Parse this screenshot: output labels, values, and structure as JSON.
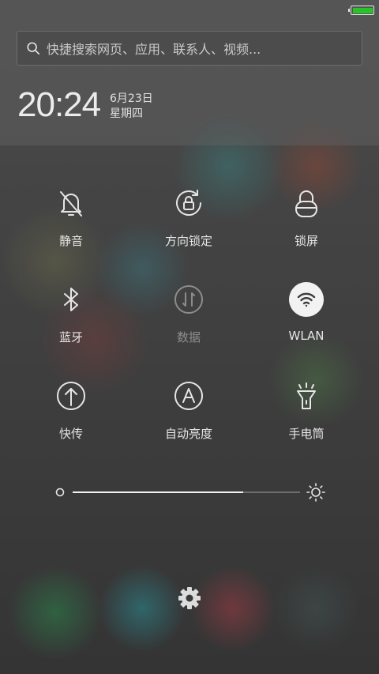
{
  "status_bar": {
    "battery_icon": "battery-icon",
    "battery_level": 1.0,
    "battery_color": "#27c327"
  },
  "search": {
    "placeholder": "快捷搜索网页、应用、联系人、视频...",
    "icon": "search-icon"
  },
  "clock": {
    "time": "20:24",
    "date": "6月23日",
    "weekday": "星期四"
  },
  "toggles": [
    {
      "label": "静音",
      "icon": "bell-off-icon",
      "active": false
    },
    {
      "label": "方向锁定",
      "icon": "rotation-lock-icon",
      "active": false
    },
    {
      "label": "锁屏",
      "icon": "lock-icon",
      "active": false
    },
    {
      "label": "蓝牙",
      "icon": "bluetooth-icon",
      "active": false
    },
    {
      "label": "数据",
      "icon": "mobile-data-icon",
      "active": false,
      "disabled": true
    },
    {
      "label": "WLAN",
      "icon": "wifi-icon",
      "active": true
    },
    {
      "label": "快传",
      "icon": "upload-icon",
      "active": false
    },
    {
      "label": "自动亮度",
      "icon": "auto-brightness-icon",
      "active": false
    },
    {
      "label": "手电筒",
      "icon": "flashlight-icon",
      "active": false
    }
  ],
  "brightness": {
    "level": 0.75,
    "min_icon": "brightness-low-icon",
    "max_icon": "brightness-high-icon"
  },
  "settings": {
    "icon": "gear-icon"
  }
}
